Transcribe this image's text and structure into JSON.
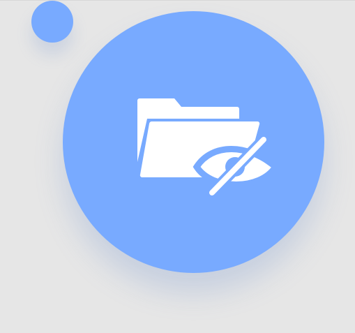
{
  "colors": {
    "background": "#e6e6e6",
    "accent": "#78aaff",
    "icon": "#ffffff"
  },
  "icons": {
    "main": "folder-hidden-icon",
    "parts": [
      "folder-icon",
      "eye-off-icon"
    ]
  }
}
